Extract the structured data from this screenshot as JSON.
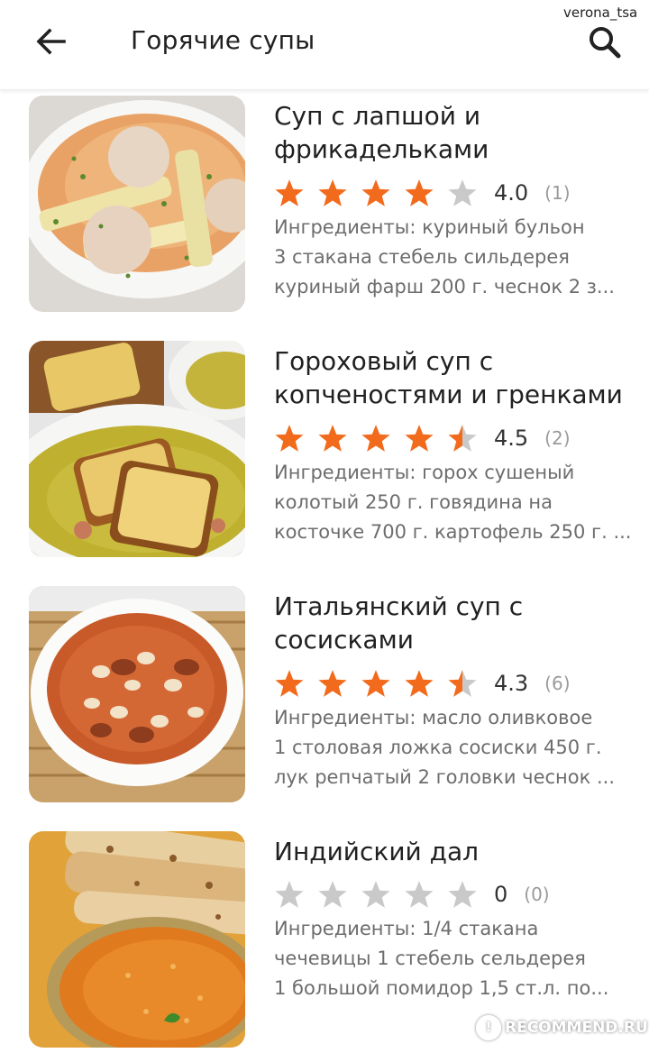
{
  "watermark_top": "verona_tsa",
  "header": {
    "title": "Горячие супы",
    "back_icon": "arrow-left-icon",
    "search_icon": "search-icon"
  },
  "colors": {
    "star_filled": "#f26b1d",
    "star_empty": "#c9c9c9"
  },
  "recipes": [
    {
      "title_lines": [
        "Суп с лапшой и",
        "фрикадельками"
      ],
      "rating": 4.0,
      "rating_value": "4.0",
      "rating_count": "(1)",
      "description": [
        "Ингредиенты: куриный бульон",
        "3 стакана стебель сильдерея",
        "куриный фарш  200 г. чеснок 2 з..."
      ]
    },
    {
      "title_lines": [
        "Гороховый суп с",
        "копченостями и гренками"
      ],
      "rating": 4.5,
      "rating_value": "4.5",
      "rating_count": "(2)",
      "description": [
        "Ингредиенты: горох сушеный",
        "колотый 250 г.  говядина на",
        "косточке 700 г. картофель 250 г. ..."
      ]
    },
    {
      "title_lines": [
        "Итальянский суп с",
        "сосисками"
      ],
      "rating": 4.5,
      "rating_value": "4.3",
      "rating_count": "(6)",
      "description": [
        "Ингредиенты: масло оливковое",
        "1 столовая ложка сосиски 450 г.",
        "лук репчатый 2 головки чеснок ..."
      ]
    },
    {
      "title_lines": [
        "Индийский дал"
      ],
      "rating": 0,
      "rating_value": "0",
      "rating_count": "(0)",
      "description": [
        "Ингредиенты: 1/4 стакана",
        "чечевицы 1 стебель сельдерея",
        "1 большой помидор 1,5 ст.л. по..."
      ]
    }
  ],
  "watermark_bottom": "RECOMMEND.RU"
}
